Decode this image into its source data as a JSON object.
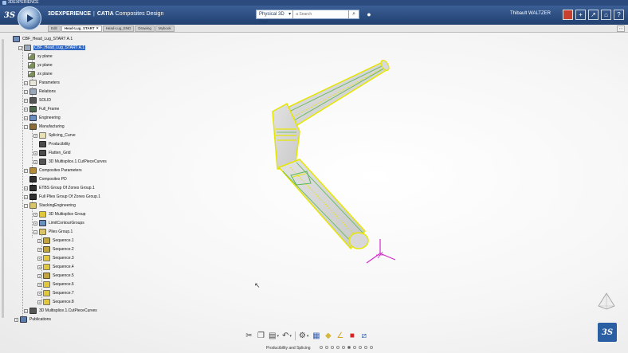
{
  "os_bar": {
    "title": "3DEXPERIENCE"
  },
  "header": {
    "brand": "3DEXPERIENCE",
    "separator": "|",
    "app": "CATIA",
    "app_name": "Composites Design",
    "search_context": "Physical 3D Part",
    "search_placeholder": "a Search",
    "user": "Thibault WALTZER"
  },
  "tabs": [
    {
      "label": "Edit"
    },
    {
      "label": "Head-Lug_START",
      "close": "×"
    },
    {
      "label": "Head-Lug_END"
    },
    {
      "label": "Drawing"
    },
    {
      "label": "Mybook"
    }
  ],
  "tab_end": "‹ ›",
  "tree": {
    "root": "CBF_Head_Lug_START A.1",
    "items": [
      {
        "label": "CBF_Head_Lug_START A.1",
        "selected": true
      },
      {
        "label": "xy plane"
      },
      {
        "label": "yz plane"
      },
      {
        "label": "zx plane"
      },
      {
        "label": "Parameters"
      },
      {
        "label": "Relations"
      },
      {
        "label": "SOLID"
      },
      {
        "label": "Full_Frame"
      },
      {
        "label": "Engineering"
      },
      {
        "label": "Manufacturing"
      },
      {
        "label": "Splicing_Curve"
      },
      {
        "label": "Producibility"
      },
      {
        "label": "Flatten_Grid"
      },
      {
        "label": "3D Multisplice.1.CutPieceCurves"
      },
      {
        "label": "Composites Parameters"
      },
      {
        "label": "Composites PD"
      },
      {
        "label": "ETBS Group Of Zones Group.1"
      },
      {
        "label": "Full Plies Group Of Zones Group.1"
      },
      {
        "label": "StackingEngineering"
      },
      {
        "label": "3D Multisplice Group"
      },
      {
        "label": "LimitContourGroups"
      },
      {
        "label": "Plies Group.1"
      },
      {
        "label": "Sequence.1"
      },
      {
        "label": "Sequence.2"
      },
      {
        "label": "Sequence.3"
      },
      {
        "label": "Sequence.4"
      },
      {
        "label": "Sequence.5"
      },
      {
        "label": "Sequence.6"
      },
      {
        "label": "Sequence.7"
      },
      {
        "label": "Sequence.8"
      },
      {
        "label": "3D Multisplice.1.CutPieceCurves"
      },
      {
        "label": "Publications"
      }
    ]
  },
  "footer": {
    "section_label": "Producibility and Splicing"
  },
  "colors": {
    "accent": "#2e67c3",
    "topbar": "#21406f",
    "part_edge": "#e6e600",
    "part_inner": "#58b84f",
    "axis": "#d42bc9"
  }
}
